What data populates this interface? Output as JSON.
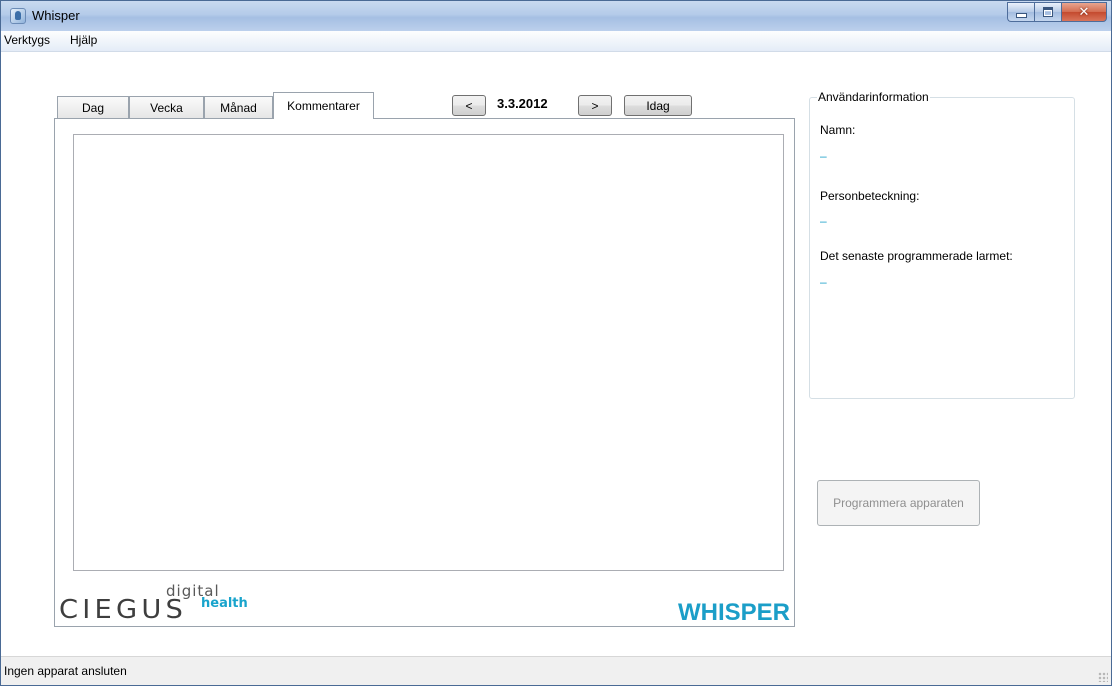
{
  "window": {
    "title": "Whisper"
  },
  "menu": {
    "items": [
      "Verktygs",
      "Hjälp"
    ]
  },
  "tabs": [
    "Dag",
    "Vecka",
    "Månad",
    "Kommentarer"
  ],
  "active_tab": "Kommentarer",
  "nav": {
    "prev_label": "<",
    "date": "3.3.2012",
    "next_label": ">",
    "today_label": "Idag"
  },
  "comments": {
    "value": ""
  },
  "user_info": {
    "title": "Användarinformation",
    "name_label": "Namn:",
    "name_value": "–",
    "id_label": "Personbeteckning:",
    "id_value": "–",
    "alarm_label": "Det senaste programmerade larmet:",
    "alarm_value": "–"
  },
  "program_button": "Programmera apparaten",
  "branding": {
    "company_top": "digital",
    "company_main": "CIEGUS",
    "company_sub": "health",
    "product": "WHISPER"
  },
  "status": {
    "text": "Ingen apparat ansluten"
  },
  "colors": {
    "accent": "#1b9ec8",
    "titlebar": "#b4cbe9",
    "close": "#c44a2e"
  }
}
